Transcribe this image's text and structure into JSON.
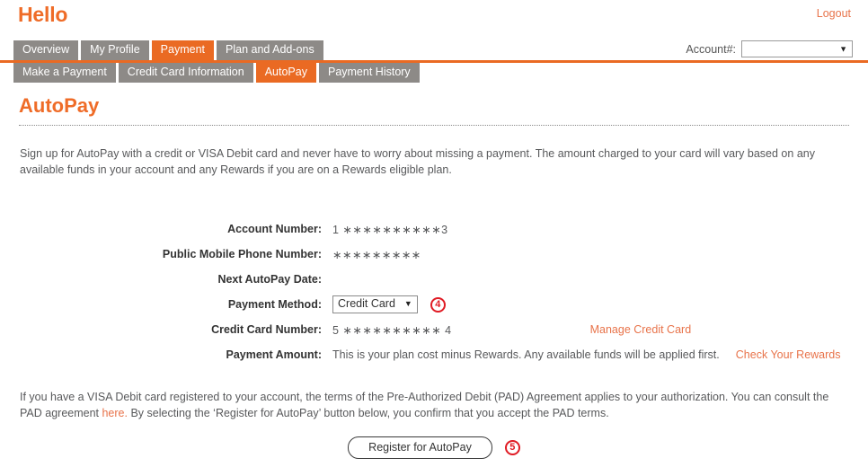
{
  "header": {
    "greeting": "Hello",
    "logout_label": "Logout",
    "account_label": "Account#:",
    "account_value": "",
    "dropdown_arrow": "▼"
  },
  "tabs_primary": [
    {
      "label": "Overview",
      "active": false
    },
    {
      "label": "My Profile",
      "active": false
    },
    {
      "label": "Payment",
      "active": true
    },
    {
      "label": "Plan and Add-ons",
      "active": false
    }
  ],
  "tabs_secondary": [
    {
      "label": "Make a Payment",
      "active": false
    },
    {
      "label": "Credit Card Information",
      "active": false
    },
    {
      "label": "AutoPay",
      "active": true
    },
    {
      "label": "Payment History",
      "active": false
    }
  ],
  "page": {
    "title": "AutoPay",
    "intro": "Sign up for AutoPay with a credit or VISA Debit card and never have to worry about missing a payment. The amount charged to your card will vary based on any available funds in your account and any Rewards if you are on a Rewards eligible plan."
  },
  "form": {
    "account_number_label": "Account Number:",
    "account_number_value": "1 ∗∗∗∗∗∗∗∗∗∗3",
    "phone_label": "Public Mobile Phone Number:",
    "phone_value": "∗∗∗∗∗∗∗∗∗",
    "next_date_label": "Next AutoPay Date:",
    "next_date_value": "",
    "payment_method_label": "Payment Method:",
    "payment_method_value": "Credit Card",
    "payment_method_badge": "4",
    "credit_card_label": "Credit Card Number:",
    "credit_card_value": "5 ∗∗∗∗∗∗∗∗∗∗ 4",
    "manage_card_link": "Manage Credit Card",
    "payment_amount_label": "Payment Amount:",
    "payment_amount_value": "This is your plan cost minus Rewards. Any available funds will be applied first.",
    "check_rewards_link": "Check Your Rewards"
  },
  "pad": {
    "text_before_link": "If you have a VISA Debit card registered to your account, the terms of the Pre-Authorized Debit (PAD) Agreement applies to your authorization. You can consult the PAD agreement ",
    "link_label": "here.",
    "text_after_link": " By selecting the ‘Register for AutoPay’ button below, you confirm that you accept the PAD terms."
  },
  "submit": {
    "button_label": "Register for AutoPay",
    "badge": "5"
  },
  "colors": {
    "brand_orange": "#ef6c28",
    "tab_orange": "#ea6a23",
    "tab_gray": "#8d8a87",
    "link_orange": "#e8734a",
    "badge_red": "#e01b24"
  }
}
